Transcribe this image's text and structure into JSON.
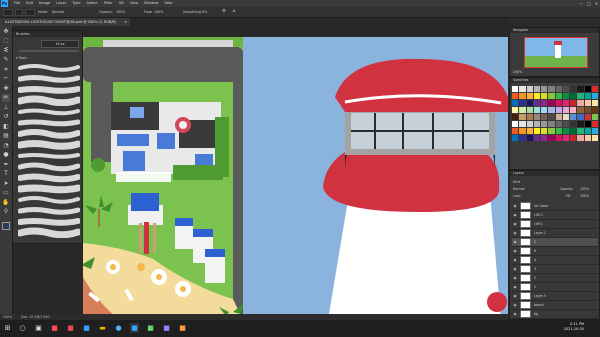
{
  "app": {
    "logo": "Ps"
  },
  "menubar": {
    "items": [
      "File",
      "Edit",
      "Image",
      "Layer",
      "Type",
      "Select",
      "Filter",
      "3D",
      "View",
      "Window",
      "Help"
    ],
    "minimize": "—",
    "maximize": "□",
    "close": "✕"
  },
  "options": {
    "mode_label": "Mode:",
    "mode_value": "Normal",
    "opacity_label": "Opacity:",
    "opacity_value": "100%",
    "flow_label": "Flow:",
    "flow_value": "100%",
    "smoothing_label": "Smoothing:",
    "smoothing_value": "0%"
  },
  "document": {
    "tab_title": "ILLUSTRATION: LIGHTHOUSE FRONT@(60.psd @ 200% (3, RGB/8)",
    "close": "×"
  },
  "brushes": {
    "title": "Brushes",
    "size": "16 px",
    "folder": "Tools"
  },
  "navigator": {
    "title": "Navigator",
    "zoom": "200%"
  },
  "swatches": {
    "title": "Swatches"
  },
  "layers": {
    "title": "Layers",
    "kind_label": "Kind",
    "blend_mode": "Normal",
    "opacity_label": "Opacity:",
    "opacity_value": "100%",
    "lock_label": "Lock:",
    "fill_label": "Fill:",
    "fill_value": "100%",
    "items": [
      "roll lower",
      "cliff 2",
      "cliff 1",
      "Layer 1",
      "5",
      "6",
      "4",
      "3",
      "2",
      "1",
      "Layer 5",
      "beach",
      "bg"
    ]
  },
  "status": {
    "zoom": "200%",
    "doc": "Doc: 10.2M/1.09G"
  },
  "taskbar": {
    "time": "2:11 PM",
    "date": "2021-10-05"
  },
  "colors": {
    "sky": "#8ab4dd",
    "lighthouse_red": "#d0323f",
    "lighthouse_white": "#ffffff",
    "grass": "#7cc24f",
    "sand": "#f3dc9b"
  }
}
